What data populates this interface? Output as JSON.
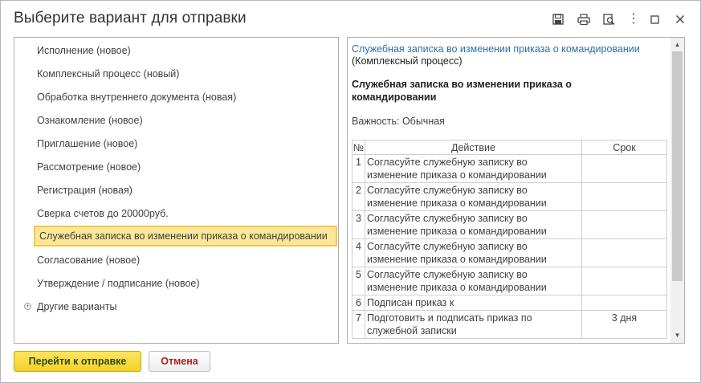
{
  "window": {
    "title": "Выберите вариант для отправки",
    "menu_dots": "⋮"
  },
  "variants": [
    {
      "label": "Исполнение (новое)"
    },
    {
      "label": "Комплексный процесс (новый)"
    },
    {
      "label": "Обработка внутреннего документа (новая)"
    },
    {
      "label": "Ознакомление (новое)"
    },
    {
      "label": "Приглашение (новое)"
    },
    {
      "label": "Рассмотрение (новое)"
    },
    {
      "label": "Регистрация (новая)"
    },
    {
      "label": "Сверка счетов до 20000руб."
    },
    {
      "label": "Служебная записка во изменении приказа о командировании",
      "selected": true
    },
    {
      "label": "Согласование (новое)"
    },
    {
      "label": "Утверждение / подписание (новое)"
    },
    {
      "label": "Другие варианты"
    }
  ],
  "preview": {
    "title_link": "Служебная записка во изменении приказа о командировании",
    "subtitle": "(Комплексный процесс)",
    "heading": "Служебная записка во изменении приказа о командировании",
    "importance": "Важность: Обычная",
    "columns": {
      "num": "№",
      "action": "Действие",
      "term": "Срок"
    },
    "steps": [
      {
        "num": "1",
        "action": "Согласуйте служебную записку во изменение приказа о командировании",
        "term": ""
      },
      {
        "num": "2",
        "action": "Согласуйте служебную записку во изменение приказа о командировании",
        "term": ""
      },
      {
        "num": "3",
        "action": "Согласуйте служебную записку во изменение приказа о командировании",
        "term": ""
      },
      {
        "num": "4",
        "action": "Согласуйте служебную записку во изменение приказа о командировании",
        "term": ""
      },
      {
        "num": "5",
        "action": "Согласуйте служебную записку во изменение приказа о командировании",
        "term": ""
      },
      {
        "num": "6",
        "action": "Подписан приказ к",
        "term": ""
      },
      {
        "num": "7",
        "action": "Подготовить и подписать приказ по служебной записки",
        "term": "3 дня"
      }
    ]
  },
  "buttons": {
    "go_to_send": "Перейти к отправке",
    "cancel": "Отмена"
  },
  "colors": {
    "selected_bg": "#fbe797",
    "selected_border": "#f2c84a",
    "link": "#2f6fa6",
    "primary_button": "#f3d12a",
    "cancel_text": "#b02020"
  }
}
